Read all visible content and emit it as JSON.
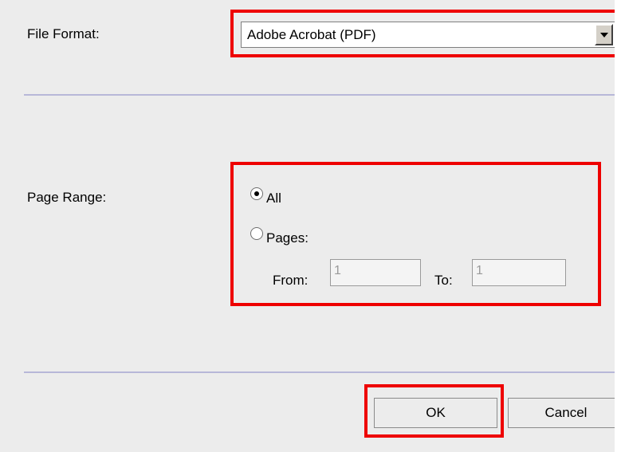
{
  "file_format": {
    "label": "File Format:",
    "selected": "Adobe Acrobat (PDF)"
  },
  "page_range": {
    "label": "Page Range:",
    "options": [
      {
        "label": "All",
        "selected": true
      },
      {
        "label": "Pages:",
        "selected": false
      }
    ],
    "from_label": "From:",
    "from_value": "1",
    "to_label": "To:",
    "to_value": "1"
  },
  "buttons": {
    "ok": "OK",
    "cancel": "Cancel"
  },
  "colors": {
    "highlight": "#ee0000",
    "background": "#ececec",
    "divider": "#b7b7d8"
  },
  "icons": {
    "dropdown": "chevron-down-icon",
    "radio_selected": "radio-selected-icon",
    "radio_unselected": "radio-unselected-icon"
  }
}
